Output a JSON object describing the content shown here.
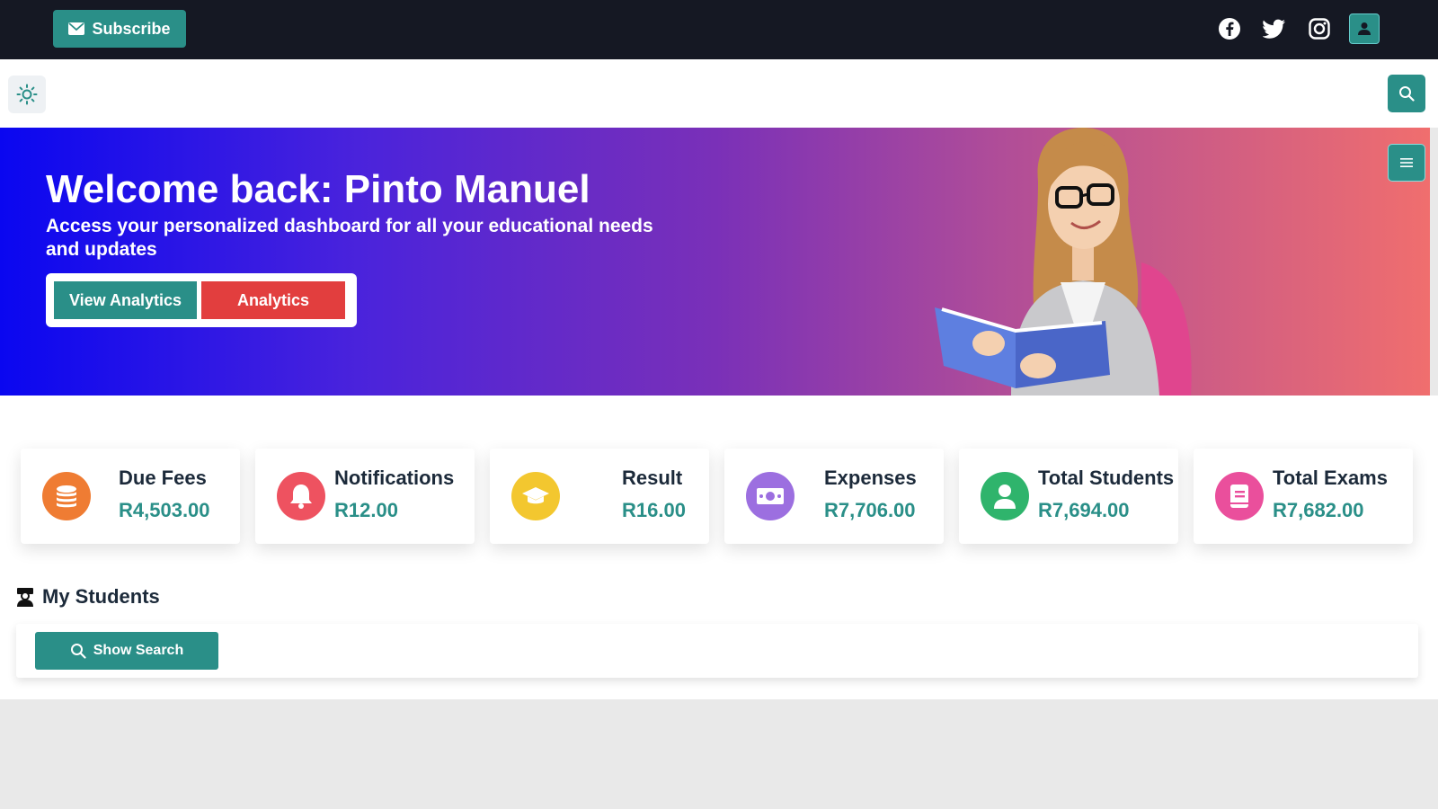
{
  "topbar": {
    "subscribe_label": "Subscribe",
    "icons": [
      "envelope-icon",
      "facebook-icon",
      "twitter-icon",
      "instagram-icon",
      "user-icon"
    ]
  },
  "navbar": {
    "theme_icon": "sun-icon",
    "search_icon": "search-icon"
  },
  "hero": {
    "title": "Welcome back: Pinto Manuel",
    "subtitle": "Access your personalized dashboard for all your educational needs and updates",
    "primary_button": "View Analytics",
    "secondary_button": "Analytics",
    "menu_icon": "hamburger-icon"
  },
  "stats": [
    {
      "label": "Due Fees",
      "value": "R4,503.00",
      "icon": "coins-icon",
      "color": "#ef7c33"
    },
    {
      "label": "Notifications",
      "value": "R12.00",
      "icon": "bell-icon",
      "color": "#ee5260"
    },
    {
      "label": "Result",
      "value": "R16.00",
      "icon": "graduation-cap-icon",
      "color": "#f3c72f"
    },
    {
      "label": "Expenses",
      "value": "R7,706.00",
      "icon": "money-bill-icon",
      "color": "#9c6fe0"
    },
    {
      "label": "Total Students",
      "value": "R7,694.00",
      "icon": "user-icon",
      "color": "#2fb46c"
    },
    {
      "label": "Total Exams",
      "value": "R7,682.00",
      "icon": "book-icon",
      "color": "#ea4f9c"
    }
  ],
  "students_section": {
    "title": "My Students",
    "show_search_label": "Show Search"
  },
  "colors": {
    "accent": "#2a8f88",
    "danger": "#e23e3e",
    "topbar_bg": "#151823"
  }
}
